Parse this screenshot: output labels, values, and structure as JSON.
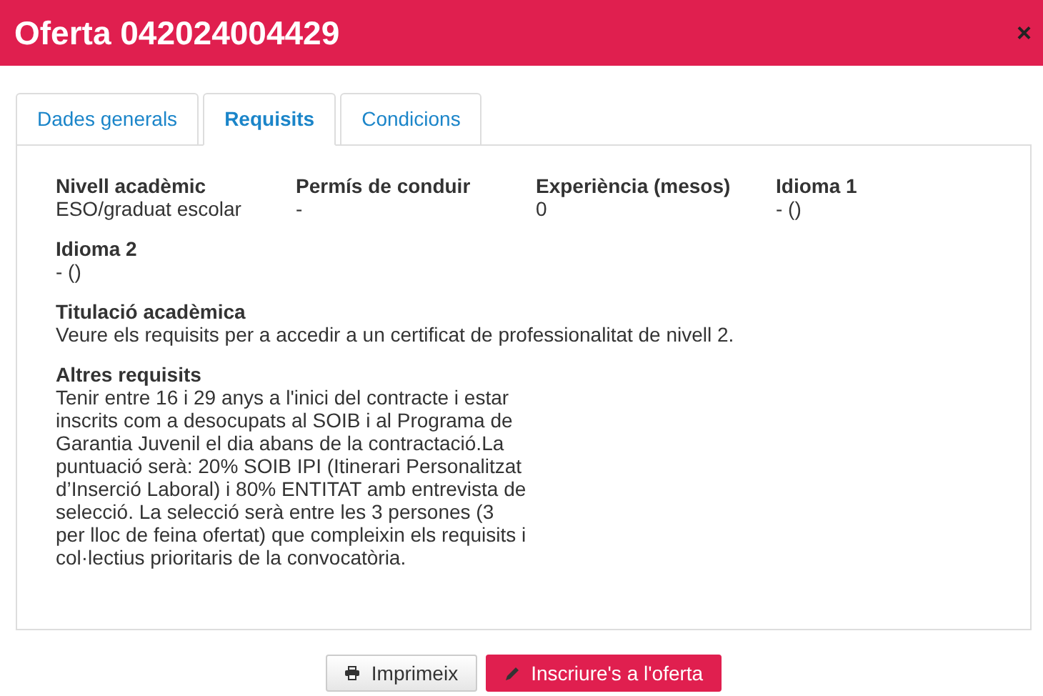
{
  "window": {
    "title": "Oferta 042024004429",
    "close": "×"
  },
  "tabs": [
    {
      "label": "Dades generals",
      "selected": false
    },
    {
      "label": "Requisits",
      "selected": true
    },
    {
      "label": "Condicions",
      "selected": false
    }
  ],
  "fields": [
    {
      "label": "Nivell acadèmic",
      "value": "ESO/graduat escolar"
    },
    {
      "label": "Permís de conduir",
      "value": "-"
    },
    {
      "label": "Experiència (mesos)",
      "value": "0"
    },
    {
      "label": "Idioma 1",
      "value": "- ()"
    },
    {
      "label": "Idioma 2",
      "value": "- ()"
    }
  ],
  "sections": [
    {
      "label": "Titulació acadèmica",
      "text": "Veure els requisits per a accedir a un certificat de professionalitat de nivell 2.",
      "kind": "wide"
    },
    {
      "label": "Altres requisits",
      "text": "Tenir entre 16 i 29 anys a l'inici del contracte i estar inscrits com a desocupats al SOIB i al Programa de Garantia Juvenil el dia abans de la contractació.La puntuació serà: 20% SOIB IPI (Itinerari Personalitzat d’Inserció Laboral) i 80% ENTITAT amb entrevista de selecció. La selecció serà entre les 3 persones (3 per lloc de feina ofertat) que compleixin els requisits i col·lectius prioritaris de la convocatòria.",
      "kind": "narrow"
    }
  ],
  "buttons": [
    {
      "label": "Imprimeix",
      "kind": "print"
    },
    {
      "label": "Inscriure's a l'oferta",
      "kind": "primary"
    }
  ]
}
